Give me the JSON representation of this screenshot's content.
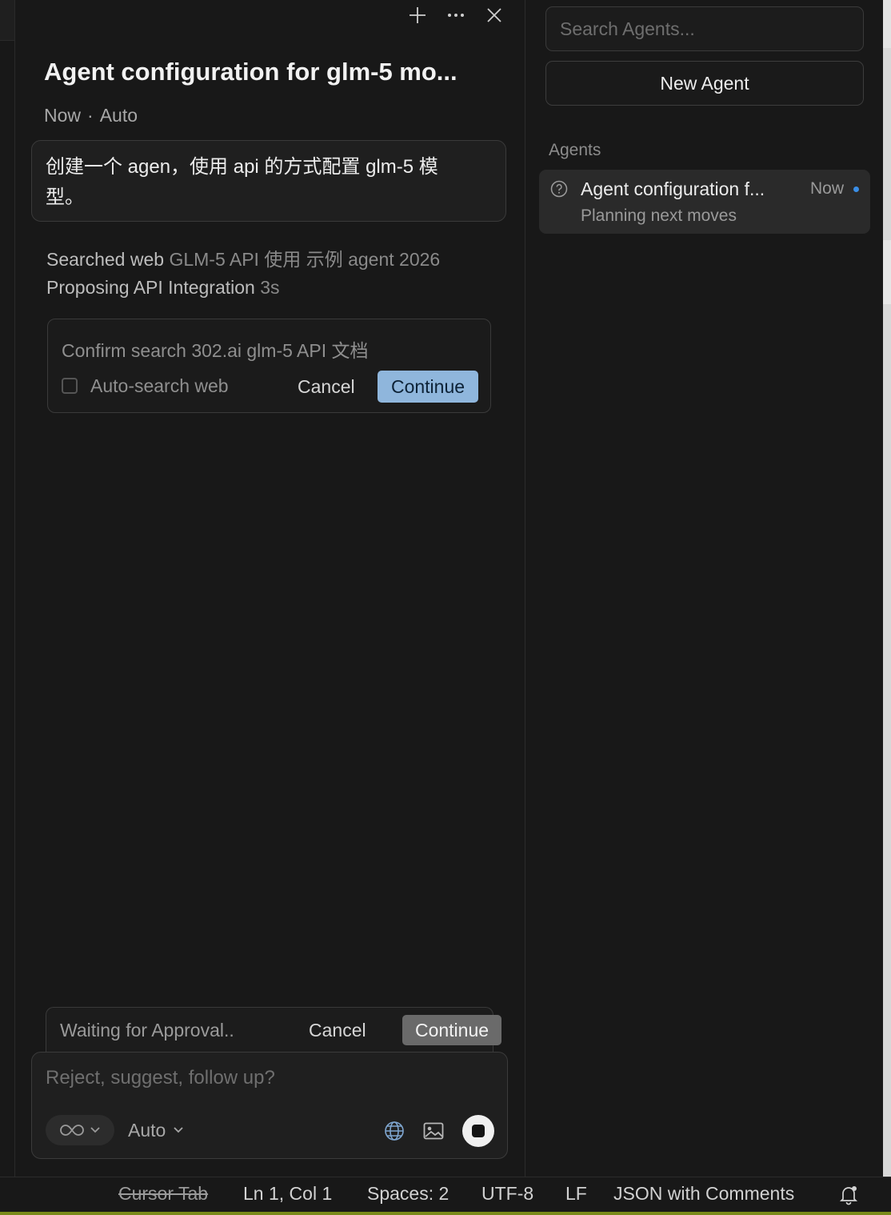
{
  "chat": {
    "title": "Agent configuration for glm-5 mo...",
    "meta_time": "Now",
    "meta_model": "Auto",
    "user_message": "创建一个 agen，使用 api 的方式配置 glm-5 模型。",
    "steps": [
      {
        "action": "Searched web",
        "detail": "GLM-5 API 使用 示例 agent 2026"
      },
      {
        "action": "Proposing API Integration",
        "detail": "3s"
      }
    ],
    "confirm": {
      "text": "Confirm search 302.ai glm-5 API 文档",
      "checkbox_label": "Auto-search web",
      "checkbox_checked": false,
      "cancel_label": "Cancel",
      "continue_label": "Continue"
    },
    "approval": {
      "status": "Waiting for Approval..",
      "cancel_label": "Cancel",
      "continue_label": "Continue"
    },
    "composer": {
      "placeholder": "Reject, suggest, follow up?",
      "mode_icon": "infinity-icon",
      "model_label": "Auto"
    },
    "top_icons": [
      "plus-icon",
      "ellipsis-icon",
      "close-icon"
    ]
  },
  "agents_panel": {
    "search_placeholder": "Search Agents...",
    "new_agent_label": "New Agent",
    "section_heading": "Agents",
    "items": [
      {
        "title": "Agent configuration f...",
        "time": "Now",
        "subtitle": "Planning next moves",
        "status_icon": "question-circle-icon",
        "unread": true
      }
    ]
  },
  "status_bar": {
    "cursor_tab": "Cursor Tab",
    "position": "Ln 1, Col 1",
    "spaces": "Spaces: 2",
    "encoding": "UTF-8",
    "eol": "LF",
    "language": "JSON with Comments"
  },
  "colors": {
    "background": "#181818",
    "continue_primary": "#8fb6dc",
    "continue_secondary": "#6a6a6a",
    "unread_dot": "#3a8ee6",
    "accent_bottom": "#7a8a1a"
  }
}
